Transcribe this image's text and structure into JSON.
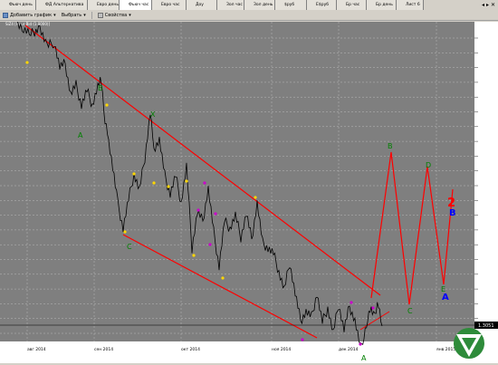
{
  "tabs": [
    {
      "label": "Фьюч день",
      "active": false
    },
    {
      "label": "ФД Альтернатива",
      "active": false
    },
    {
      "label": "Евро день",
      "active": false
    },
    {
      "label": "Фьюч час",
      "active": true
    },
    {
      "label": "Евро час",
      "active": false
    },
    {
      "label": "Доу",
      "active": false
    },
    {
      "label": "Зол час",
      "active": false
    },
    {
      "label": "Зол день",
      "active": false
    },
    {
      "label": "$руб",
      "active": false
    },
    {
      "label": "E$руб",
      "active": false
    },
    {
      "label": "Бр час",
      "active": false
    },
    {
      "label": "Бр день",
      "active": false
    },
    {
      "label": "Лист 6",
      "active": false
    }
  ],
  "toolbar": {
    "add_chart": "Добавить график",
    "select": "Выбрать",
    "properties": "Свойства"
  },
  "chart": {
    "legend": "SiZ4 [Hour Bid (1.0000)]",
    "price_label": "1.3051",
    "x_labels": [
      "авг 2014",
      "сен 2014",
      "окт 2014",
      "ноя 2014",
      "дек 2014",
      "янв 2015"
    ],
    "colors": {
      "background": "#7f7f7f",
      "price": "#000000",
      "channel": "#ff0000",
      "forecast": "#ff0000",
      "green_label": "#008000",
      "yellow_label": "#ffd700",
      "magenta_label": "#cc00cc",
      "big_label_red": "#ff0000",
      "big_label_blue": "#0000ff"
    },
    "wave_labels": {
      "B_top": "B",
      "A_left": "A",
      "X": "X",
      "C_left": "C",
      "A_bottom": "A",
      "proj_B": "B",
      "proj_C": "C",
      "proj_D": "D",
      "proj_E": "E",
      "big_2": "2",
      "big_B": "B",
      "big_A": "A"
    }
  }
}
